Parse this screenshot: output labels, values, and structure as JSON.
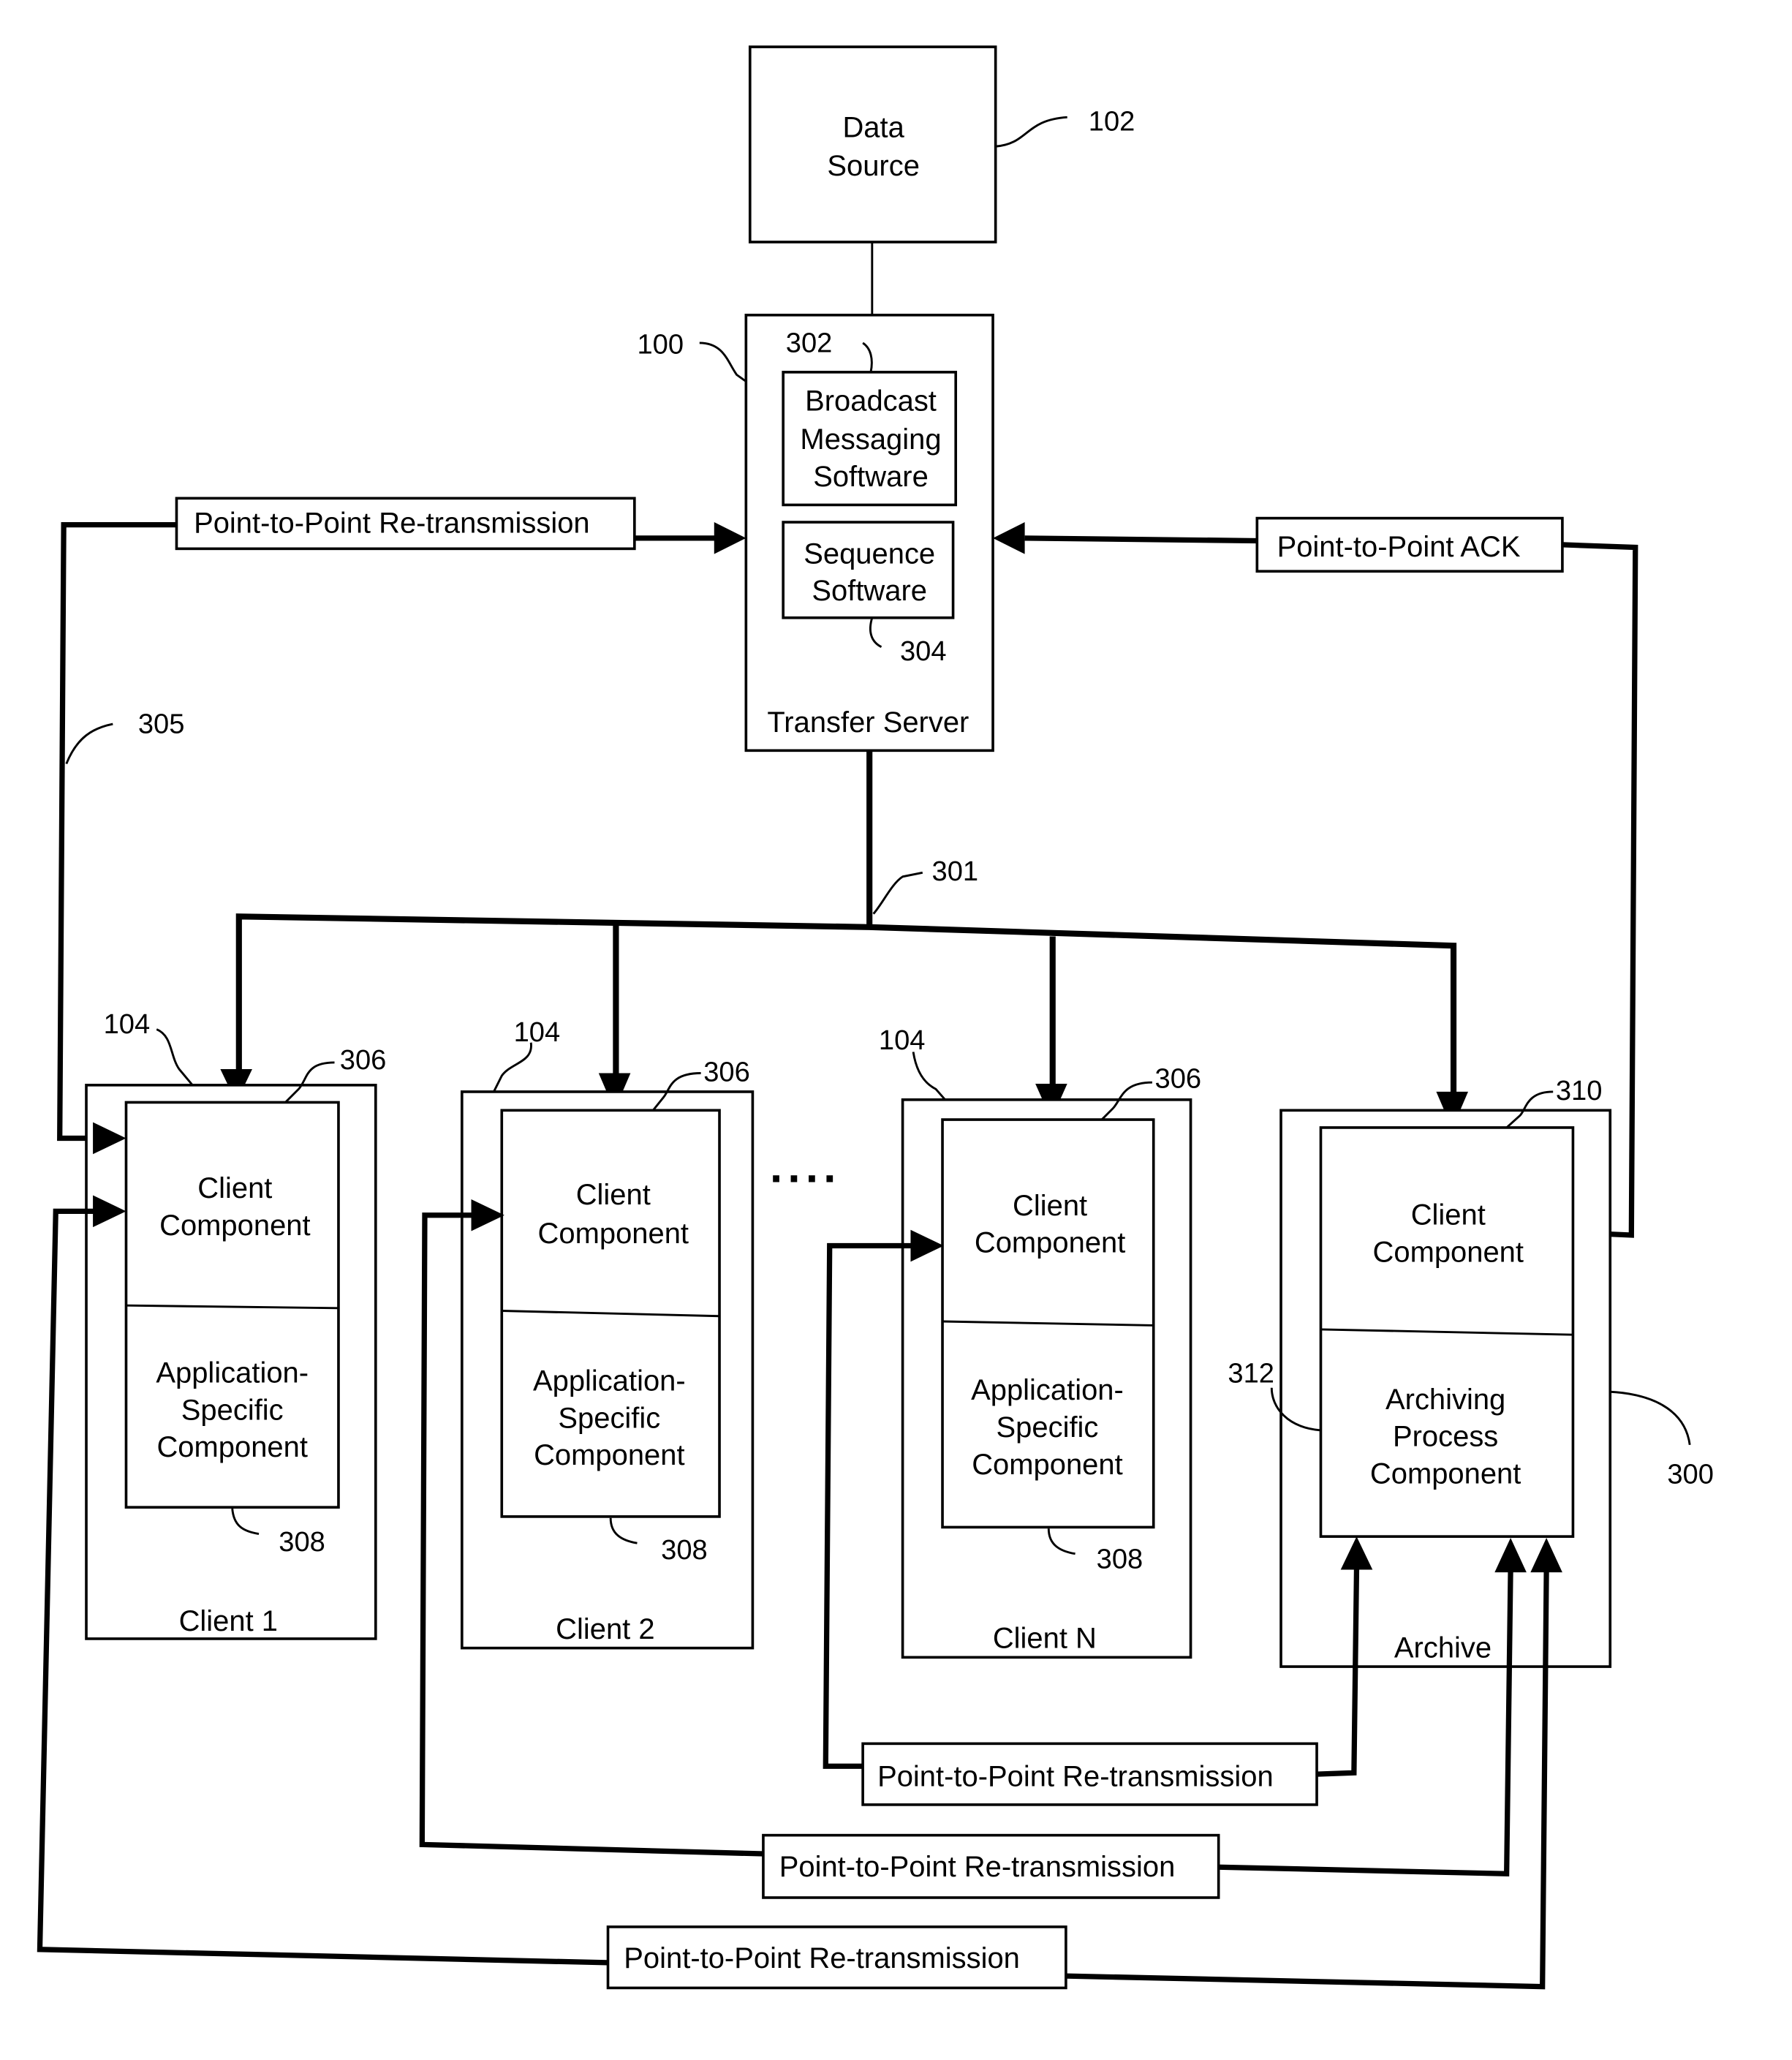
{
  "figure": {
    "data_source": {
      "lines": [
        "Data",
        "Source"
      ],
      "ref": "102"
    },
    "transfer_server": {
      "label": "Transfer Server",
      "ref": "100",
      "broadcast": {
        "lines": [
          "Broadcast",
          "Messaging",
          "Software"
        ],
        "ref": "302"
      },
      "sequence": {
        "lines": [
          "Sequence",
          "Software"
        ],
        "ref": "304"
      }
    },
    "links": {
      "retrans_top": "Point-to-Point Re-transmission",
      "ack": "Point-to-Point ACK",
      "retrans_ref": "305",
      "bus_ref": "301",
      "retrans_n": "Point-to-Point Re-transmission",
      "retrans_2": "Point-to-Point Re-transmission",
      "retrans_1": "Point-to-Point Re-transmission"
    },
    "clients": [
      {
        "name": "Client 1",
        "ref": "104",
        "client_component": [
          "Client",
          "Component"
        ],
        "client_ref": "306",
        "app_component": [
          "Application-",
          "Specific",
          "Component"
        ],
        "app_ref": "308"
      },
      {
        "name": "Client 2",
        "ref": "104",
        "client_component": [
          "Client",
          "Component"
        ],
        "client_ref": "306",
        "app_component": [
          "Application-",
          "Specific",
          "Component"
        ],
        "app_ref": "308"
      },
      {
        "name": "Client N",
        "ref": "104",
        "client_component": [
          "Client",
          "Component"
        ],
        "client_ref": "306",
        "app_component": [
          "Application-",
          "Specific",
          "Component"
        ],
        "app_ref": "308"
      }
    ],
    "ellipsis": "....",
    "archive": {
      "name": "Archive",
      "ref": "300",
      "client_component": [
        "Client",
        "Component"
      ],
      "client_ref": "310",
      "archiving_component": [
        "Archiving",
        "Process",
        "Component"
      ],
      "archiving_ref": "312"
    }
  }
}
